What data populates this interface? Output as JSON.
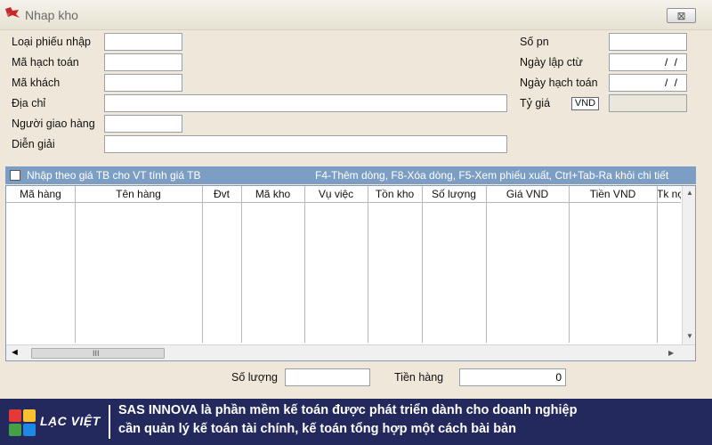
{
  "window": {
    "title": "Nhap kho",
    "close_glyph": "⊠"
  },
  "form": {
    "left_labels": [
      "Loại phiếu nhập",
      "Mã hạch toán",
      "Mã khách",
      "Địa chỉ",
      "Người giao hàng",
      "Diễn giải"
    ],
    "right_labels": [
      "Số pn",
      "Ngày lập ctừ",
      "Ngày hạch toán",
      "Tỷ giá"
    ],
    "date_placeholder": "/ /",
    "currency_badge": "VND"
  },
  "grid": {
    "checkbox_label": "Nhập theo giá TB cho VT tính giá TB",
    "hotkeys": "F4-Thêm dòng, F8-Xóa dòng, F5-Xem phiếu xuất, Ctrl+Tab-Ra khỏi chi tiết",
    "columns": [
      "Mã hàng",
      "Tên hàng",
      "Đvt",
      "Mã kho",
      "Vụ việc",
      "Tồn kho",
      "Số lượng",
      "Giá VND",
      "Tiền VND",
      "Tk nợ"
    ],
    "record_marker": "◄",
    "thumb_grip": "III"
  },
  "totals": {
    "qty_label": "Số lượng",
    "qty_value": "",
    "amount_label": "Tiền hàng",
    "amount_value": "0"
  },
  "banner": {
    "logo_text": "LẠC VIỆT",
    "line1": "SAS INNOVA là phần mềm kế toán được phát triển dành cho doanh nghiệp",
    "line2": "cần quản lý kế toán tài chính, kế toán tổng hợp một cách bài bản"
  },
  "colors": {
    "grid_header": "#7c9ec4",
    "banner_bg": "#23295c",
    "form_bg": "#efe8da"
  }
}
